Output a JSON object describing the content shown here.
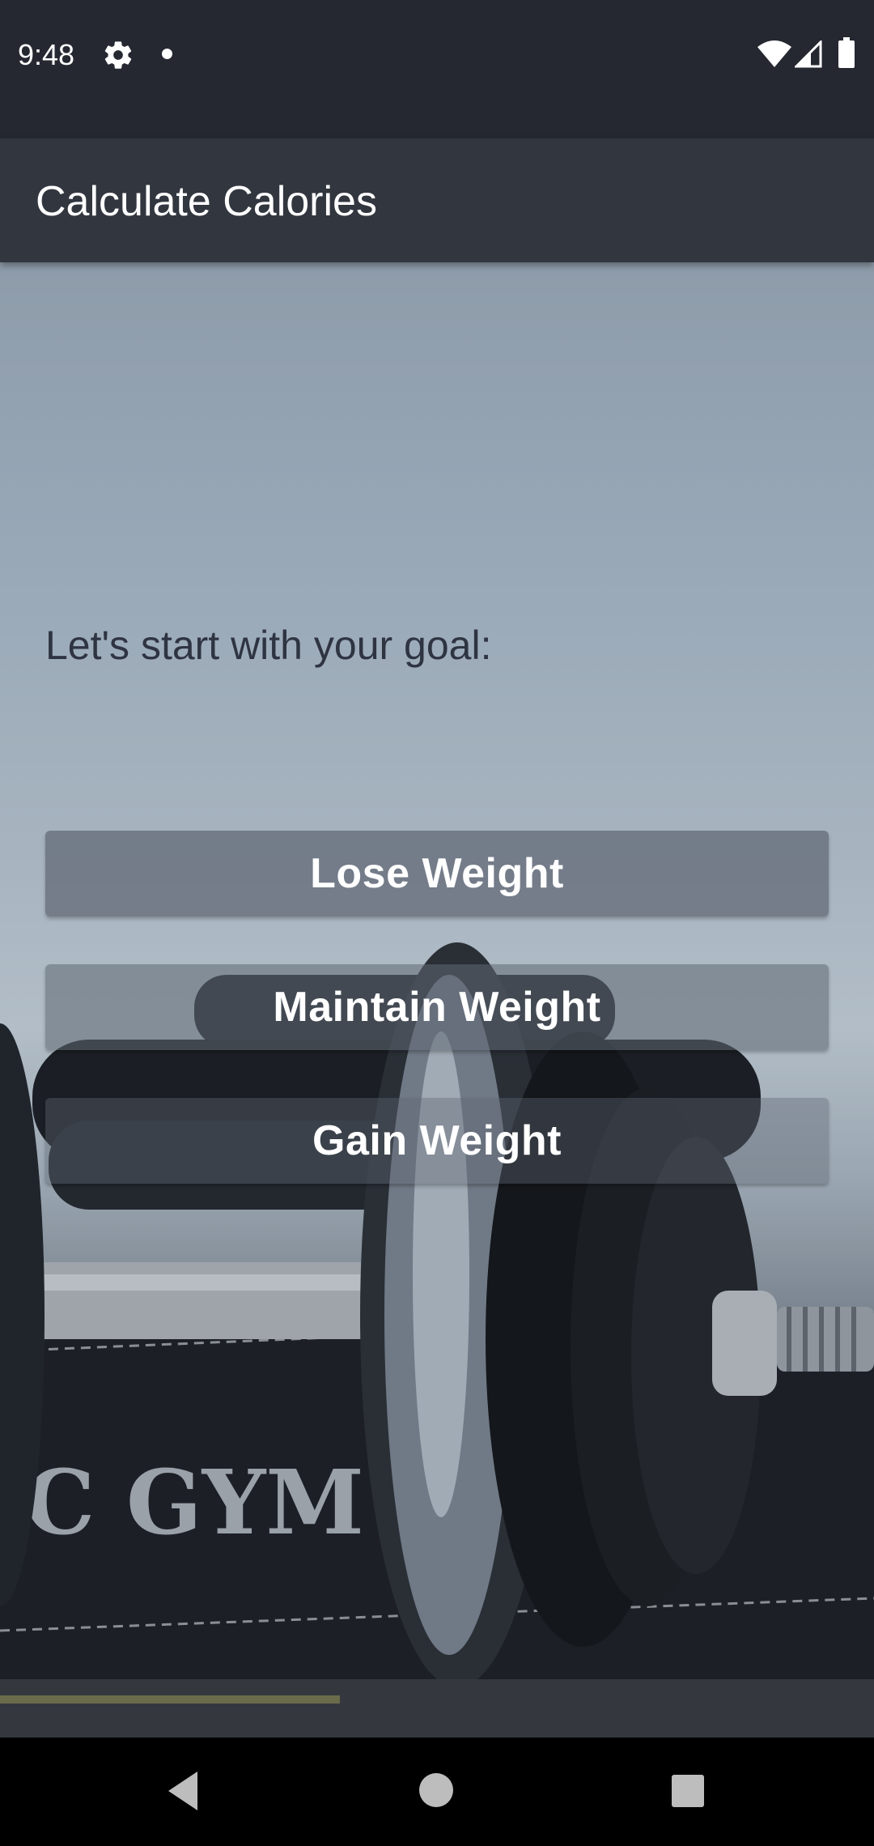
{
  "status_bar": {
    "time": "9:48",
    "icons": [
      "gear-icon",
      "notification-dot-icon",
      "wifi-icon",
      "signal-icon",
      "battery-icon"
    ]
  },
  "app_bar": {
    "title": "Calculate Calories"
  },
  "main": {
    "prompt": "Let's start with your goal:",
    "buttons": {
      "lose": "Lose Weight",
      "maintain": "Maintain Weight",
      "gain": "Gain Weight"
    },
    "background_text": "C GYM"
  },
  "nav_bar": {
    "icons": [
      "back-icon",
      "home-icon",
      "recents-icon"
    ]
  },
  "colors": {
    "status_bar": "#252831",
    "app_bar": "#32363f",
    "button": "#5f6773",
    "text_dark": "#2f3442"
  }
}
